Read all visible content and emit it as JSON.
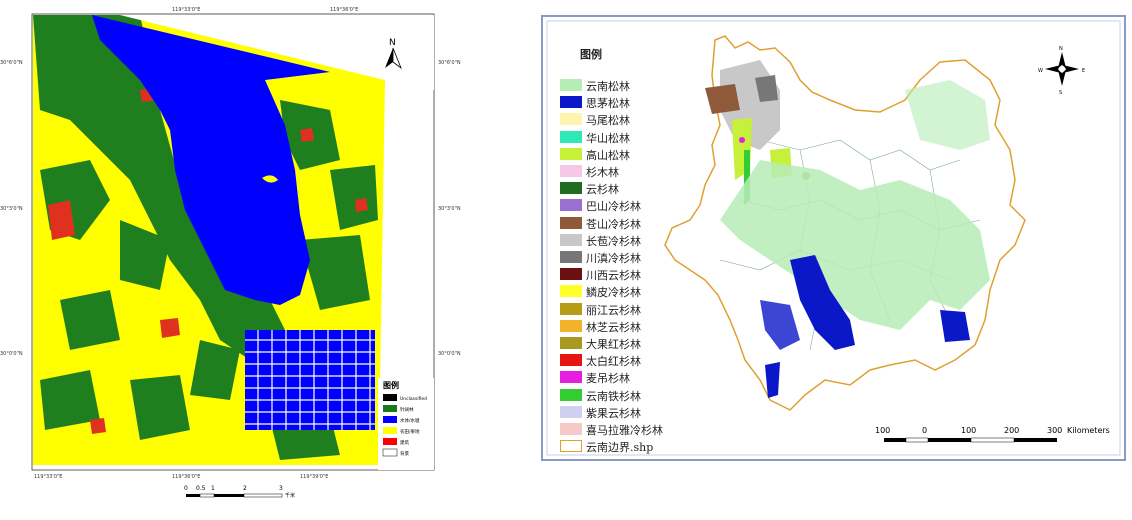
{
  "left_map": {
    "north_label": "N",
    "left_lat_labels": [
      "30°6'0\"N",
      "30°3'0\"N",
      "30°0'0\"N"
    ],
    "right_lat_labels": [
      "30°6'0\"N",
      "30°3'0\"N",
      "30°0'0\"N"
    ],
    "bottom_lon_labels": [
      "119°33'0\"E",
      "119°36'0\"E",
      "119°39'0\"E"
    ],
    "top_lon_labels": [
      "119°33'0\"E",
      "119°36'0\"E"
    ],
    "legend": {
      "title": "图例",
      "items": [
        {
          "label": "Unclassified",
          "color": "#000000"
        },
        {
          "label": "针阔林",
          "color": "#1a7a1a"
        },
        {
          "label": "水体/水塘",
          "color": "#0000ff"
        },
        {
          "label": "农田/果地",
          "color": "#ffff00"
        },
        {
          "label": "建筑",
          "color": "#ff0000"
        },
        {
          "label": "背景",
          "color": "#ffffff"
        }
      ]
    },
    "scale": {
      "ticks": [
        "0",
        "0.5",
        "1",
        "2",
        "3"
      ],
      "unit": "千米"
    }
  },
  "right_map": {
    "legend_title": "图例",
    "legend_items": [
      {
        "label": "云南松林",
        "color": "#b6ecb6"
      },
      {
        "label": "思茅松林",
        "color": "#0b18c8"
      },
      {
        "label": "马尾松林",
        "color": "#fff3b0"
      },
      {
        "label": "华山松林",
        "color": "#2ee8b8"
      },
      {
        "label": "高山松林",
        "color": "#c6f03a"
      },
      {
        "label": "杉木林",
        "color": "#f6c8e8"
      },
      {
        "label": "云杉林",
        "color": "#1f6b1f"
      },
      {
        "label": "巴山冷杉林",
        "color": "#9b6fd0"
      },
      {
        "label": "苍山冷杉林",
        "color": "#8f5a3a"
      },
      {
        "label": "长苞冷杉林",
        "color": "#c8c8c8"
      },
      {
        "label": "川滇冷杉林",
        "color": "#777777"
      },
      {
        "label": "川西云杉林",
        "color": "#6a0f12"
      },
      {
        "label": "鳞皮冷杉林",
        "color": "#ffff2a"
      },
      {
        "label": "丽江云杉林",
        "color": "#b59e16"
      },
      {
        "label": "林芝云杉林",
        "color": "#f2b22a"
      },
      {
        "label": "大果红杉林",
        "color": "#a89a20"
      },
      {
        "label": "太白红杉林",
        "color": "#e81515"
      },
      {
        "label": "麦吊杉林",
        "color": "#e51ee0"
      },
      {
        "label": "云南铁杉林",
        "color": "#33cc33"
      },
      {
        "label": "紫果云杉林",
        "color": "#cfcff0"
      },
      {
        "label": "喜马拉雅冷杉林",
        "color": "#f6c8c8"
      },
      {
        "label": "云南边界.shp",
        "color": "#e0a030"
      }
    ],
    "compass": {
      "n": "N",
      "s": "S",
      "w": "W",
      "e": "E"
    },
    "scale": {
      "ticks": [
        "100",
        "0",
        "100",
        "200",
        "300"
      ],
      "unit": "Kilometers"
    }
  }
}
